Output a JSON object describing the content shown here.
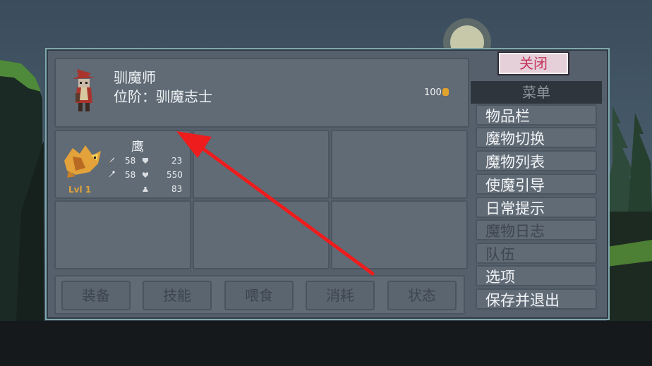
{
  "player": {
    "title": "驯魔师",
    "rank": "位阶：驯魔志士",
    "gold": "100"
  },
  "monster": {
    "name": "鹰",
    "level": "Lvl 1",
    "attack": "58",
    "magic": "58",
    "defense": "23",
    "health": "550",
    "stat3": "83"
  },
  "actions": [
    "装备",
    "技能",
    "喂食",
    "消耗",
    "状态"
  ],
  "menu": {
    "close": "关闭",
    "header": "菜单",
    "items": [
      {
        "label": "物品栏",
        "enabled": true
      },
      {
        "label": "魔物切换",
        "enabled": true
      },
      {
        "label": "魔物列表",
        "enabled": true
      },
      {
        "label": "使魔引导",
        "enabled": true
      },
      {
        "label": "日常提示",
        "enabled": true
      },
      {
        "label": "魔物日志",
        "enabled": false
      },
      {
        "label": "队伍",
        "enabled": false
      },
      {
        "label": "选项",
        "enabled": true
      },
      {
        "label": "保存并退出",
        "enabled": true
      }
    ]
  },
  "colors": {
    "panel": "#55606c",
    "border": "#7fa8ad",
    "arrow": "#ee1c1c",
    "close_text": "#c5365e",
    "level": "#e0a33a"
  },
  "icons": [
    "sword-icon",
    "shield-icon",
    "wand-icon",
    "heart-icon",
    "pouch-icon",
    "coin-icon",
    "tamer-sprite",
    "eagle-sprite"
  ]
}
